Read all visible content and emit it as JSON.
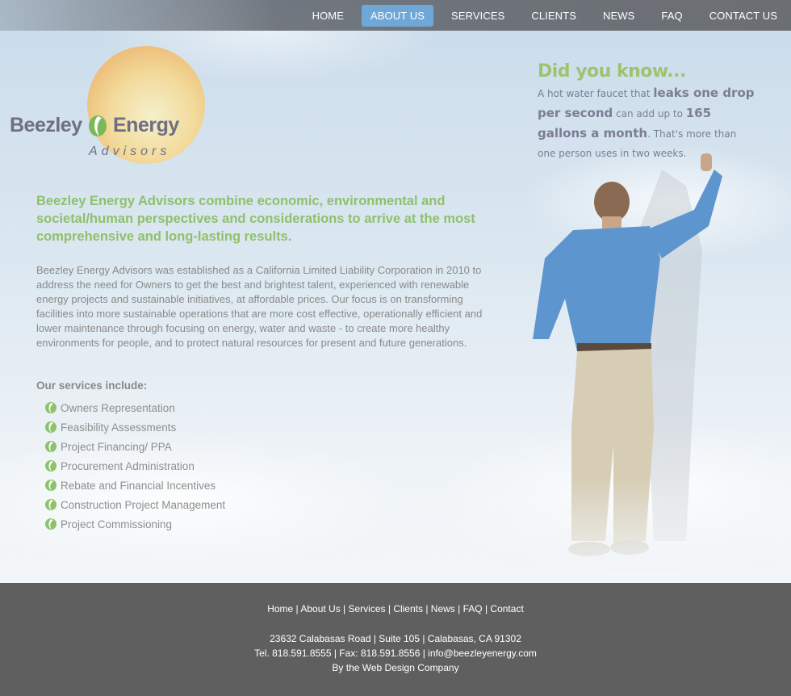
{
  "nav": {
    "items": [
      {
        "label": "HOME"
      },
      {
        "label": "ABOUT US"
      },
      {
        "label": "SERVICES"
      },
      {
        "label": "CLIENTS"
      },
      {
        "label": "NEWS"
      },
      {
        "label": "FAQ"
      },
      {
        "label": "CONTACT US"
      }
    ],
    "active_color": "#6fa7d6"
  },
  "logo": {
    "word1": "Beezley",
    "word2": "Energy",
    "subtitle": "Advisors"
  },
  "main": {
    "headline": "Beezley Energy Advisors combine economic, environmental and societal/human perspectives and considerations to arrive at the most comprehensive and long-lasting results.",
    "body": "Beezley Energy Advisors was established as a California Limited Liability Corporation in 2010 to address the need for Owners to get the best and brightest talent, experienced with renewable energy projects and sustainable initiatives, at affordable prices. Our focus is on transforming facilities into more sustainable operations that are more cost effective, operationally efficient and lower maintenance through focusing on energy, water and waste - to create more healthy environments for people, and to protect natural resources for present and future generations.",
    "services_heading": "Our services include:",
    "services": [
      "Owners Representation",
      "Feasibility Assessments",
      "Project Financing/ PPA",
      "Procurement Administration",
      "Rebate and Financial Incentives",
      "Construction Project Management",
      "Project Commissioning"
    ],
    "headline_color": "#8fc06d"
  },
  "tip": {
    "title": "Did you know...",
    "p1": "A hot water faucet that ",
    "p2": "leaks one drop per second",
    "p3": " can add up to ",
    "p4": "165 gallons a month",
    "p5": ". That's more than one person uses in two weeks."
  },
  "footer": {
    "links": [
      "Home",
      "About Us",
      "Services",
      "Clients",
      "News",
      "FAQ",
      "Contact"
    ],
    "address": "23632 Calabasas Road | Suite 105 | Calabasas, CA 91302",
    "contact": "Tel. 818.591.8555 | Fax: 818.591.8556 | info@beezleyenergy.com",
    "credit": "By the Web Design Company"
  }
}
